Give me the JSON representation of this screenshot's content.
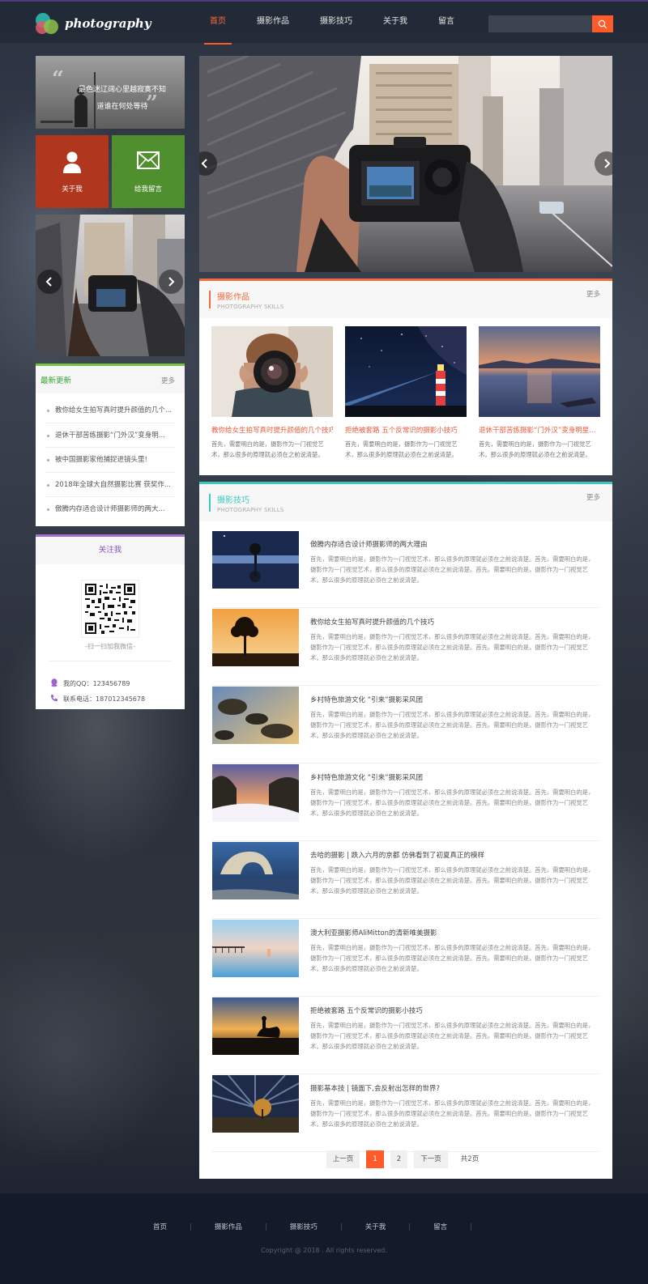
{
  "header": {
    "logo_text": "photography",
    "nav": [
      "首页",
      "摄影作品",
      "摄影技巧",
      "关于我",
      "留言"
    ],
    "active_nav": "首页",
    "search_placeholder": ""
  },
  "sidebar": {
    "quote": {
      "line1": "最色迷辽阔心里越寂寞不知",
      "line2": "道谁在何处等待"
    },
    "tiles": {
      "about_label": "关于我",
      "message_label": "给我留言"
    },
    "latest": {
      "title": "最新更新",
      "more": "更多",
      "items": [
        "教你给女生拍写真时提升颜值的几个...",
        "退休干部苦练摄影“门外汉”变身明...",
        "被中国摄影家他捕捉进镜头里!",
        "2018年全球大自然摄影比赛 获奖作...",
        "傲腾内存适合设计师摄影师的两大..."
      ]
    },
    "follow": {
      "title": "关注我",
      "qr_caption": "-扫一扫加我微信-",
      "qq_label": "我的QQ：",
      "qq": "123456789",
      "phone_label": "联系电话：",
      "phone": "187012345678"
    }
  },
  "works": {
    "title": "摄影作品",
    "subtitle": "PHOTOGRAPHY SKILLS",
    "more": "更多",
    "items": [
      {
        "title": "教你给女生拍写真时提升颜值的几个技巧",
        "desc": "首先，需要明白的是，摄影作为一门视觉艺术，那么很多的原理就必须在之前说清楚。"
      },
      {
        "title": "拒绝被套路 五个反常识的摄影小技巧",
        "desc": "首先，需要明白的是，摄影作为一门视觉艺术，那么很多的原理就必须在之前说清楚。"
      },
      {
        "title": "退休干部苦练摄影“门外汉”变身明星...",
        "desc": "首先，需要明白的是，摄影作为一门视觉艺术，那么很多的原理就必须在之前说清楚。"
      }
    ]
  },
  "tips": {
    "title": "摄影技巧",
    "subtitle": "PHOTOGRAPHY SKILLS",
    "more": "更多",
    "desc": "首先，需要明白的是，摄影作为一门视觉艺术，那么很多的原理就必须在之前说清楚。首先，需要明白的是，摄影作为一门视觉艺术，那么很多的原理就必须在之前说清楚。首先，需要明白的是，摄影作为一门视觉艺术，那么很多的原理就必须在之前说清楚。",
    "items": [
      "傲腾内存适合设计师摄影师的两大理由",
      "教你给女生拍写真时提升颜值的几个技巧",
      "乡村特色旅游文化 “引来”摄影采风团",
      "乡村特色旅游文化 “引来”摄影采风团",
      "去哈的摄影 | 跌入六月的京都 仿佛看到了初夏真正的模样",
      "澳大利亚摄影师AliMitton的清新唯美摄影",
      "拒绝被套路 五个反常识的摄影小技巧",
      "摄影基本技 | 镜面下,会反射出怎样的世界?"
    ]
  },
  "pager": {
    "prev": "上一页",
    "pages": [
      "1",
      "2"
    ],
    "current": "1",
    "next": "下一页",
    "total": "共2页"
  },
  "footer": {
    "nav": [
      "首页",
      "摄影作品",
      "摄影技巧",
      "关于我",
      "留言"
    ],
    "copyright": "Copyright @ 2018 . All rights reserved."
  },
  "colors": {
    "accent": "#ff5a2a",
    "green": "#76c043",
    "purple": "#a46ad0",
    "teal": "#3cc7c1"
  }
}
